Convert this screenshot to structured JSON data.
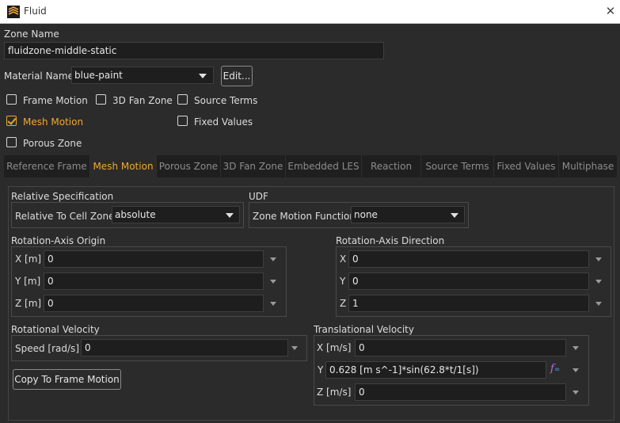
{
  "window": {
    "title": "Fluid",
    "close_icon": "close-icon"
  },
  "zone": {
    "label": "Zone Name",
    "value": "fluidzone-middle-static"
  },
  "material": {
    "label": "Material Name",
    "value": "blue-paint",
    "edit_label": "Edit..."
  },
  "options": [
    {
      "label": "Frame Motion",
      "checked": false
    },
    {
      "label": "3D Fan Zone",
      "checked": false
    },
    {
      "label": "Source Terms",
      "checked": false
    },
    {
      "label": "Mesh Motion",
      "checked": true
    },
    {
      "label": "Fixed Values",
      "checked": false
    },
    {
      "label": "Porous Zone",
      "checked": false
    }
  ],
  "tabs": [
    {
      "label": "Reference Frame",
      "active": false
    },
    {
      "label": "Mesh Motion",
      "active": true
    },
    {
      "label": "Porous Zone",
      "active": false
    },
    {
      "label": "3D Fan Zone",
      "active": false
    },
    {
      "label": "Embedded LES",
      "active": false
    },
    {
      "label": "Reaction",
      "active": false
    },
    {
      "label": "Source Terms",
      "active": false
    },
    {
      "label": "Fixed Values",
      "active": false
    },
    {
      "label": "Multiphase",
      "active": false
    }
  ],
  "relative_spec": {
    "title": "Relative Specification",
    "label": "Relative To Cell Zone",
    "value": "absolute"
  },
  "udf": {
    "title": "UDF",
    "label": "Zone Motion Function",
    "value": "none"
  },
  "rotation_origin": {
    "title": "Rotation-Axis Origin",
    "x_label": "X [m]",
    "x_value": "0",
    "y_label": "Y [m]",
    "y_value": "0",
    "z_label": "Z [m]",
    "z_value": "0"
  },
  "rotation_direction": {
    "title": "Rotation-Axis Direction",
    "x_label": "X",
    "x_value": "0",
    "y_label": "Y",
    "y_value": "0",
    "z_label": "Z",
    "z_value": "1"
  },
  "rotational_velocity": {
    "title": "Rotational Velocity",
    "label": "Speed [rad/s]",
    "value": "0"
  },
  "translational_velocity": {
    "title": "Translational Velocity",
    "x_label": "X [m/s]",
    "x_value": "0",
    "y_label": "Y",
    "y_value": "0.628 [m s^-1]*sin(62.8*t/1[s])",
    "z_label": "Z [m/s]",
    "z_value": "0",
    "fx_icon": "function-expression-icon"
  },
  "copy_button": {
    "label": "Copy To Frame Motion"
  },
  "colors": {
    "accent": "#f0a830",
    "background": "#2b2b2b",
    "field": "#1e1e1e"
  }
}
